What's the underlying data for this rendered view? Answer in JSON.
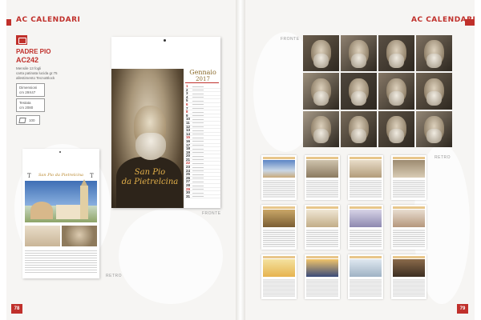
{
  "header": {
    "left_title": "AC CALENDARI",
    "right_title": "AC CALENDARI"
  },
  "product": {
    "name": "PADRE PIO",
    "code": "AC242",
    "description": "Mensile 13 fogli\ncarta patinata lucida gr.75\nallestimento TecnoBlock",
    "spec_dimensions": "Dimensioni\ncm 29X47",
    "spec_print": "Testata\ncm 2080",
    "pack_count": "100",
    "pack_icon": "box-icon"
  },
  "calendar": {
    "title_line1": "San Pio",
    "title_line2": "da Pietrelcina",
    "month": "Gennaio",
    "year": "2017",
    "days": [
      "1",
      "2",
      "3",
      "4",
      "5",
      "6",
      "7",
      "8",
      "9",
      "10",
      "11",
      "12",
      "13",
      "14",
      "15",
      "16",
      "17",
      "18",
      "19",
      "20",
      "21",
      "22",
      "23",
      "24",
      "25",
      "26",
      "27",
      "28",
      "29",
      "30",
      "31"
    ],
    "red_days": [
      "1",
      "6",
      "8",
      "15",
      "22",
      "29"
    ]
  },
  "back_page": {
    "heading": "San Pio da Pietrelcina",
    "cross_symbol": "T"
  },
  "labels": {
    "fronte_left": "FRONTE",
    "retro_left": "RETRO",
    "fronte_right": "FRONTE",
    "retro_right": "RETRO"
  },
  "page_numbers": {
    "left": "78",
    "right": "79"
  },
  "colors": {
    "brand_red": "#c0302b",
    "gold": "#e3b04a"
  }
}
